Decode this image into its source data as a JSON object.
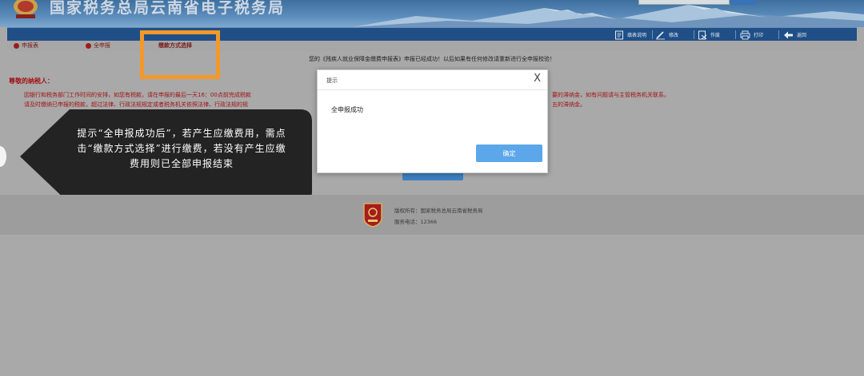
{
  "header": {
    "site_title": "国家税务总局云南省电子税务局"
  },
  "toolbar": {
    "items": [
      {
        "label": "填表说明",
        "icon": "document-icon"
      },
      {
        "label": "修改",
        "icon": "pencil-icon"
      },
      {
        "label": "作废",
        "icon": "void-document-icon"
      },
      {
        "label": "打印",
        "icon": "printer-icon"
      },
      {
        "label": "返回",
        "icon": "back-arrow-icon"
      }
    ]
  },
  "tabs": [
    {
      "label": "申报表"
    },
    {
      "label": "全申报"
    },
    {
      "label": "缴款方式选择"
    }
  ],
  "status_message": "您的《残疾人就业保障金缴费申报表》申报已经成功！以后如果有任何修改请重新进行全申报校验！",
  "notice": {
    "title": "尊敬的纳税人：",
    "line1_start": "因银行和税务部门工作时间的安排，如您有税款，请在申报的最后一天16：00点前完成税款",
    "line1_end": "要的滞纳金，如有问题请与主管税务机关联系。",
    "line2_start": "请及时缴纳已申报的税款，超过法律、行政法规规定或者税务机关依照法律、行政法规的规",
    "line2_end": "五的滞纳金。"
  },
  "annotation": {
    "text": "提示“全申报成功后”，若产生应缴费用，需点击“缴款方式选择”进行缴费，若没有产生应缴费用则已全部申报结束"
  },
  "dialog": {
    "title": "提示",
    "close_label": "X",
    "message": "全申报成功",
    "confirm_label": "确定"
  },
  "footer": {
    "copyright": "版权所有：国家税务总局云南省税务局",
    "phone": "服务电话：12366"
  },
  "colors": {
    "toolbar_bg": "#1f4f86",
    "notice_red": "#a31212",
    "highlight_orange": "#f3982a",
    "dialog_button": "#5ba7ea",
    "overlay_gray": "#a9a9a9"
  }
}
